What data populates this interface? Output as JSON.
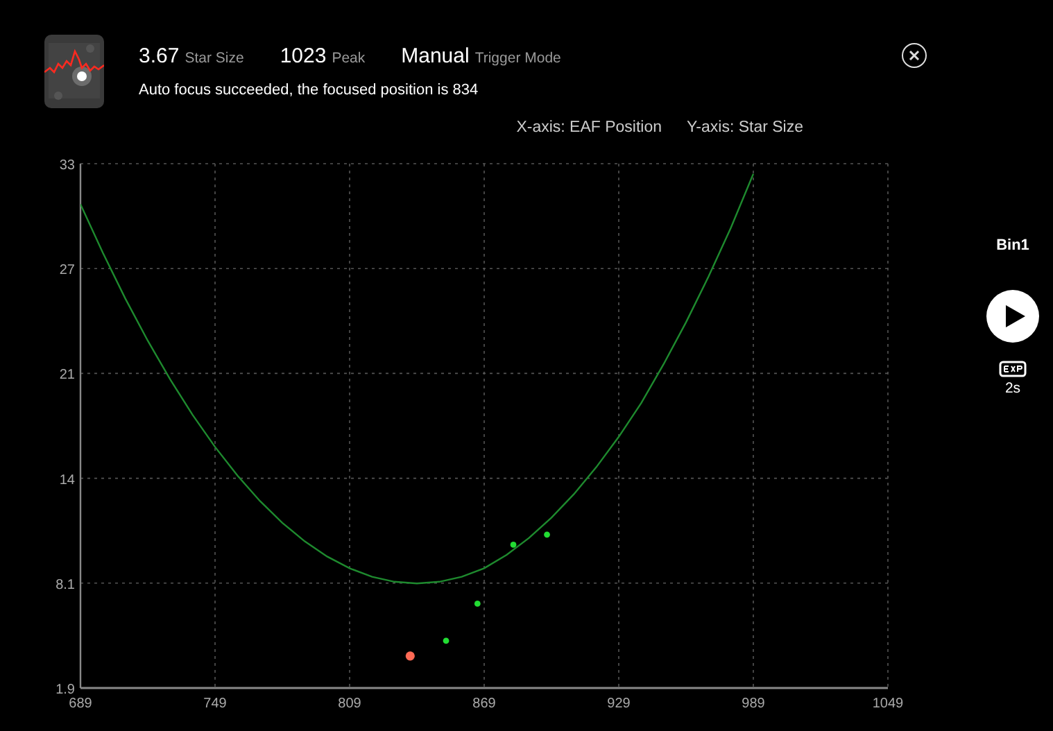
{
  "header": {
    "stats": [
      {
        "value": "3.67",
        "label": "Star Size"
      },
      {
        "value": "1023",
        "label": "Peak"
      },
      {
        "value": "Manual",
        "label": "Trigger Mode"
      }
    ],
    "message": "Auto focus succeeded, the focused position is 834"
  },
  "axis_legend": [
    "X-axis: EAF Position",
    "Y-axis: Star Size"
  ],
  "chart_data": {
    "type": "scatter",
    "xlim": [
      689,
      1049
    ],
    "ylim": [
      1.9,
      33
    ],
    "grid": true,
    "xticks": [
      689,
      749,
      809,
      869,
      929,
      989,
      1049
    ],
    "yticks": [
      {
        "value": 1.9,
        "label": "1.9"
      },
      {
        "value": 8.12,
        "label": "8.1"
      },
      {
        "value": 14.34,
        "label": "14"
      },
      {
        "value": 20.56,
        "label": "21"
      },
      {
        "value": 26.78,
        "label": "27"
      },
      {
        "value": 33,
        "label": "33"
      }
    ],
    "series": [
      {
        "type": "line",
        "color": "#1e8a2e",
        "x": [
          689,
          699,
          709,
          719,
          729,
          739,
          749,
          759,
          769,
          779,
          789,
          799,
          809,
          819,
          829,
          839,
          849,
          859,
          869,
          879,
          889,
          899,
          909,
          919,
          929,
          939,
          949,
          959,
          969,
          979,
          989
        ],
        "values": [
          30.6,
          27.7,
          25.0,
          22.5,
          20.2,
          18.1,
          16.2,
          14.5,
          13.0,
          11.7,
          10.6,
          9.7,
          9.0,
          8.5,
          8.2,
          8.1,
          8.2,
          8.5,
          9.0,
          9.8,
          10.8,
          12.0,
          13.4,
          15.0,
          16.8,
          18.8,
          21.1,
          23.6,
          26.3,
          29.2,
          32.4
        ]
      },
      {
        "color": "#22dd33",
        "x": [
          852,
          866,
          882,
          897
        ],
        "values": [
          4.7,
          6.9,
          10.4,
          11.0
        ]
      },
      {
        "color": "#ff6a55",
        "x": [
          836
        ],
        "values": [
          3.8
        ]
      }
    ]
  },
  "side_panel": {
    "binning": "Bin1",
    "exposure": "2s"
  }
}
